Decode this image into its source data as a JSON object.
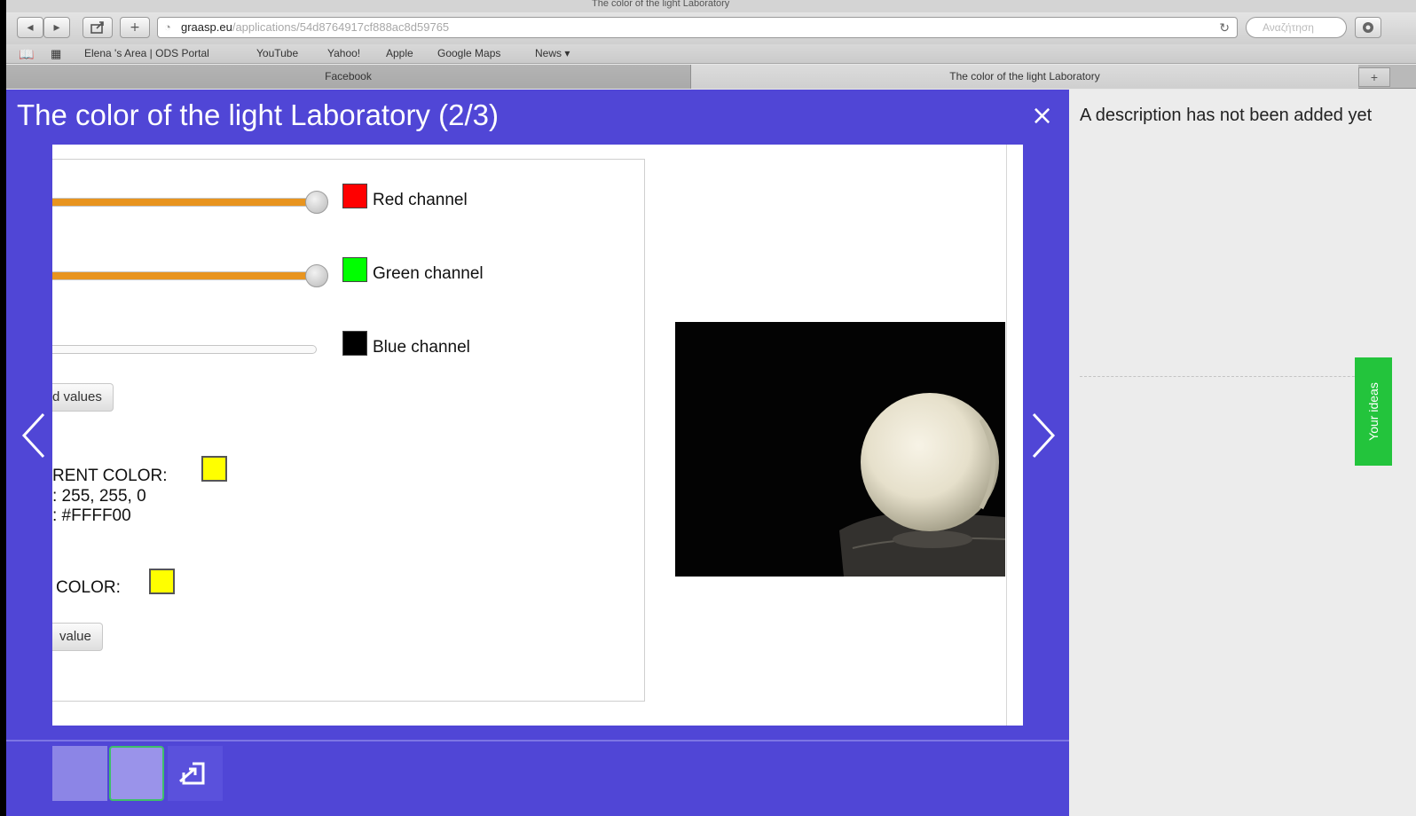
{
  "browser": {
    "window_title": "The color of the light Laboratory",
    "url_host": "graasp.eu",
    "url_path": "/applications/54d8764917cf888ac8d59765",
    "search_placeholder": "Αναζήτηση",
    "bookmarks": [
      "Elena 's Area | ODS Portal",
      "YouTube",
      "Yahoo!",
      "Apple",
      "Google Maps",
      "News ▾"
    ],
    "tabs": [
      {
        "label": "Facebook",
        "active": false
      },
      {
        "label": "The color of the light Laboratory",
        "active": true
      }
    ],
    "new_tab_label": "+"
  },
  "viewer": {
    "title": "The color of the light Laboratory (2/3)",
    "close_glyph": "×",
    "thumbnail_count": 3
  },
  "lab": {
    "channels": [
      {
        "label": "Red channel",
        "color": "#ff0000",
        "level": 1.0
      },
      {
        "label": "Green channel",
        "color": "#00ff00",
        "level": 1.0
      },
      {
        "label": "Blue channel",
        "color": "#000000",
        "level": 0.0
      }
    ],
    "random_button_label": "d values",
    "current_color": {
      "heading": "RENT COLOR:",
      "rgb_line": ": 255, 255, 0",
      "hex_line": ": #FFFF00",
      "swatch": "#ffff00"
    },
    "target_color": {
      "heading": "COLOR:",
      "swatch": "#ffff00"
    },
    "value_button_label": "value"
  },
  "sidebar": {
    "description": "A description has not been added yet",
    "ideas_tab_label": "Your ideas"
  },
  "colors": {
    "viewer_bg": "#5046d6",
    "ideas_tab": "#23c43c",
    "slider_fill": "#e8941f"
  }
}
